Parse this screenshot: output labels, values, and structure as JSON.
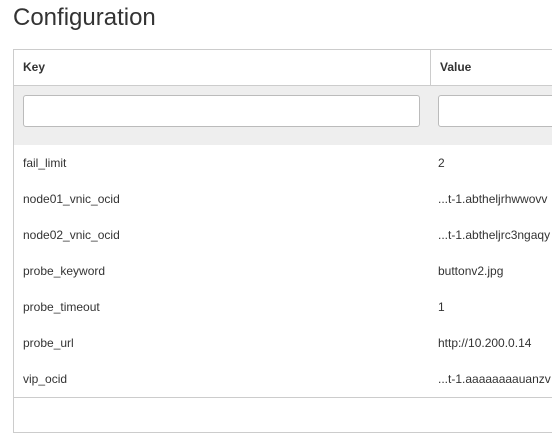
{
  "page": {
    "title": "Configuration"
  },
  "table": {
    "columns": {
      "key": "Key",
      "value": "Value"
    },
    "filters": {
      "key_value": "",
      "value_value": ""
    },
    "rows": [
      {
        "key": "fail_limit",
        "value": "2"
      },
      {
        "key": "node01_vnic_ocid",
        "value": "...t-1.abtheljrhwwovv"
      },
      {
        "key": "node02_vnic_ocid",
        "value": "...t-1.abtheljrc3ngaqy"
      },
      {
        "key": "probe_keyword",
        "value": "buttonv2.jpg"
      },
      {
        "key": "probe_timeout",
        "value": "1"
      },
      {
        "key": "probe_url",
        "value": "http://10.200.0.14"
      },
      {
        "key": "vip_ocid",
        "value": "...t-1.aaaaaaaauanzv"
      }
    ]
  }
}
